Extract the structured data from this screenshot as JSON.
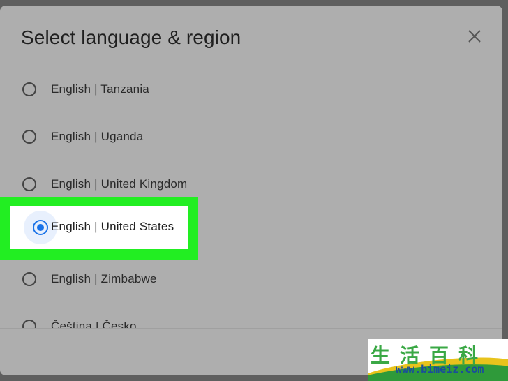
{
  "dialog": {
    "title": "Select language & region",
    "close_icon": "close-icon"
  },
  "options": [
    {
      "label": "English | Tanzania",
      "selected": false
    },
    {
      "label": "English | Uganda",
      "selected": false
    },
    {
      "label": "English | United Kingdom",
      "selected": false
    },
    {
      "label": "English | United States",
      "selected": true
    },
    {
      "label": "English | Zimbabwe",
      "selected": false
    },
    {
      "label": "Čeština | Česko",
      "selected": false
    }
  ],
  "watermark": {
    "chars": "生活百科",
    "url": "www.bimeiz.com"
  },
  "colors": {
    "accent": "#1a73e8",
    "highlight": "#22ee22"
  }
}
